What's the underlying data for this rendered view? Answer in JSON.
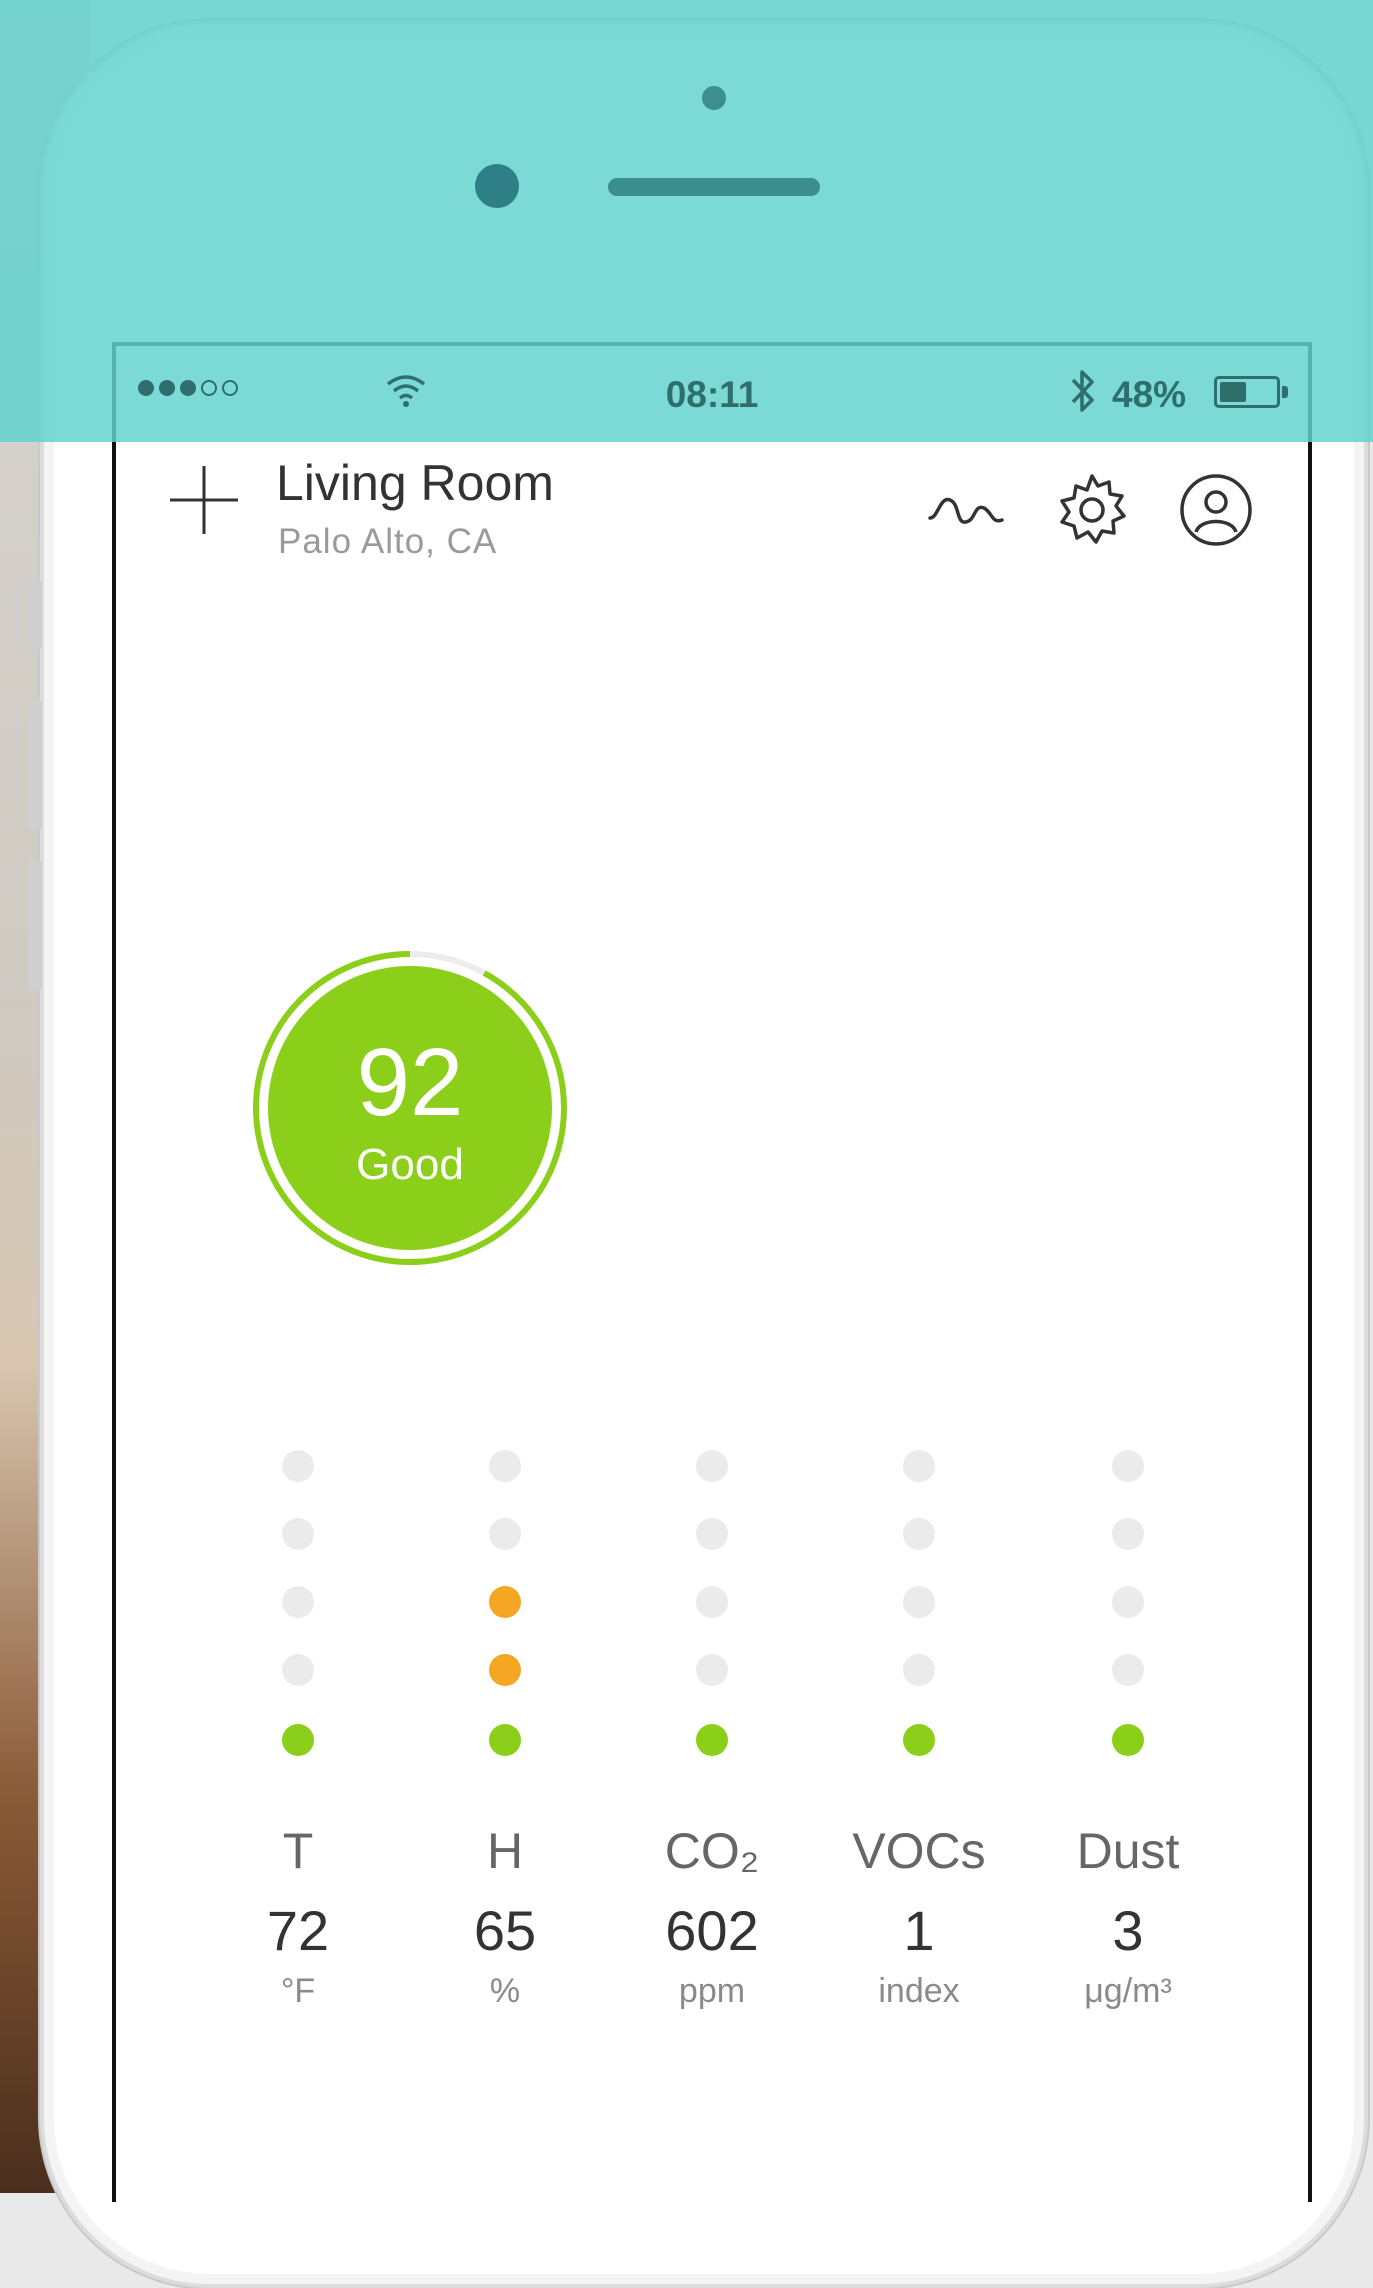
{
  "status_bar": {
    "time": "08:11",
    "battery_percent_text": "48%",
    "battery_level": 0.48,
    "signal_bars": 3,
    "signal_total": 5
  },
  "header": {
    "room_name": "Living Room",
    "location": "Palo Alto, CA",
    "icons": [
      "add-icon",
      "trend-icon",
      "gear-icon",
      "profile-icon"
    ]
  },
  "score": {
    "value": "92",
    "label": "Good",
    "color": "#8ccf1a",
    "ring_color": "#8ccf1a"
  },
  "colors": {
    "good": "#8ccf1a",
    "warning": "#f5a623",
    "inactive": "#ebebeb",
    "accent_overlay": "#62d2ce"
  },
  "metrics": [
    {
      "key": "T",
      "name": "T",
      "value": "72",
      "unit": "°F",
      "dots": [
        "good",
        "inactive",
        "inactive",
        "inactive",
        "inactive"
      ]
    },
    {
      "key": "H",
      "name": "H",
      "value": "65",
      "unit": "%",
      "dots": [
        "good",
        "warning",
        "warning",
        "inactive",
        "inactive"
      ]
    },
    {
      "key": "CO2",
      "name": "CO₂",
      "value": "602",
      "unit": "ppm",
      "dots": [
        "good",
        "inactive",
        "inactive",
        "inactive",
        "inactive"
      ]
    },
    {
      "key": "VOCs",
      "name": "VOCs",
      "value": "1",
      "unit": "index",
      "dots": [
        "good",
        "inactive",
        "inactive",
        "inactive",
        "inactive"
      ]
    },
    {
      "key": "Dust",
      "name": "Dust",
      "value": "3",
      "unit": "μg/m³",
      "dots": [
        "good",
        "inactive",
        "inactive",
        "inactive",
        "inactive"
      ]
    }
  ]
}
